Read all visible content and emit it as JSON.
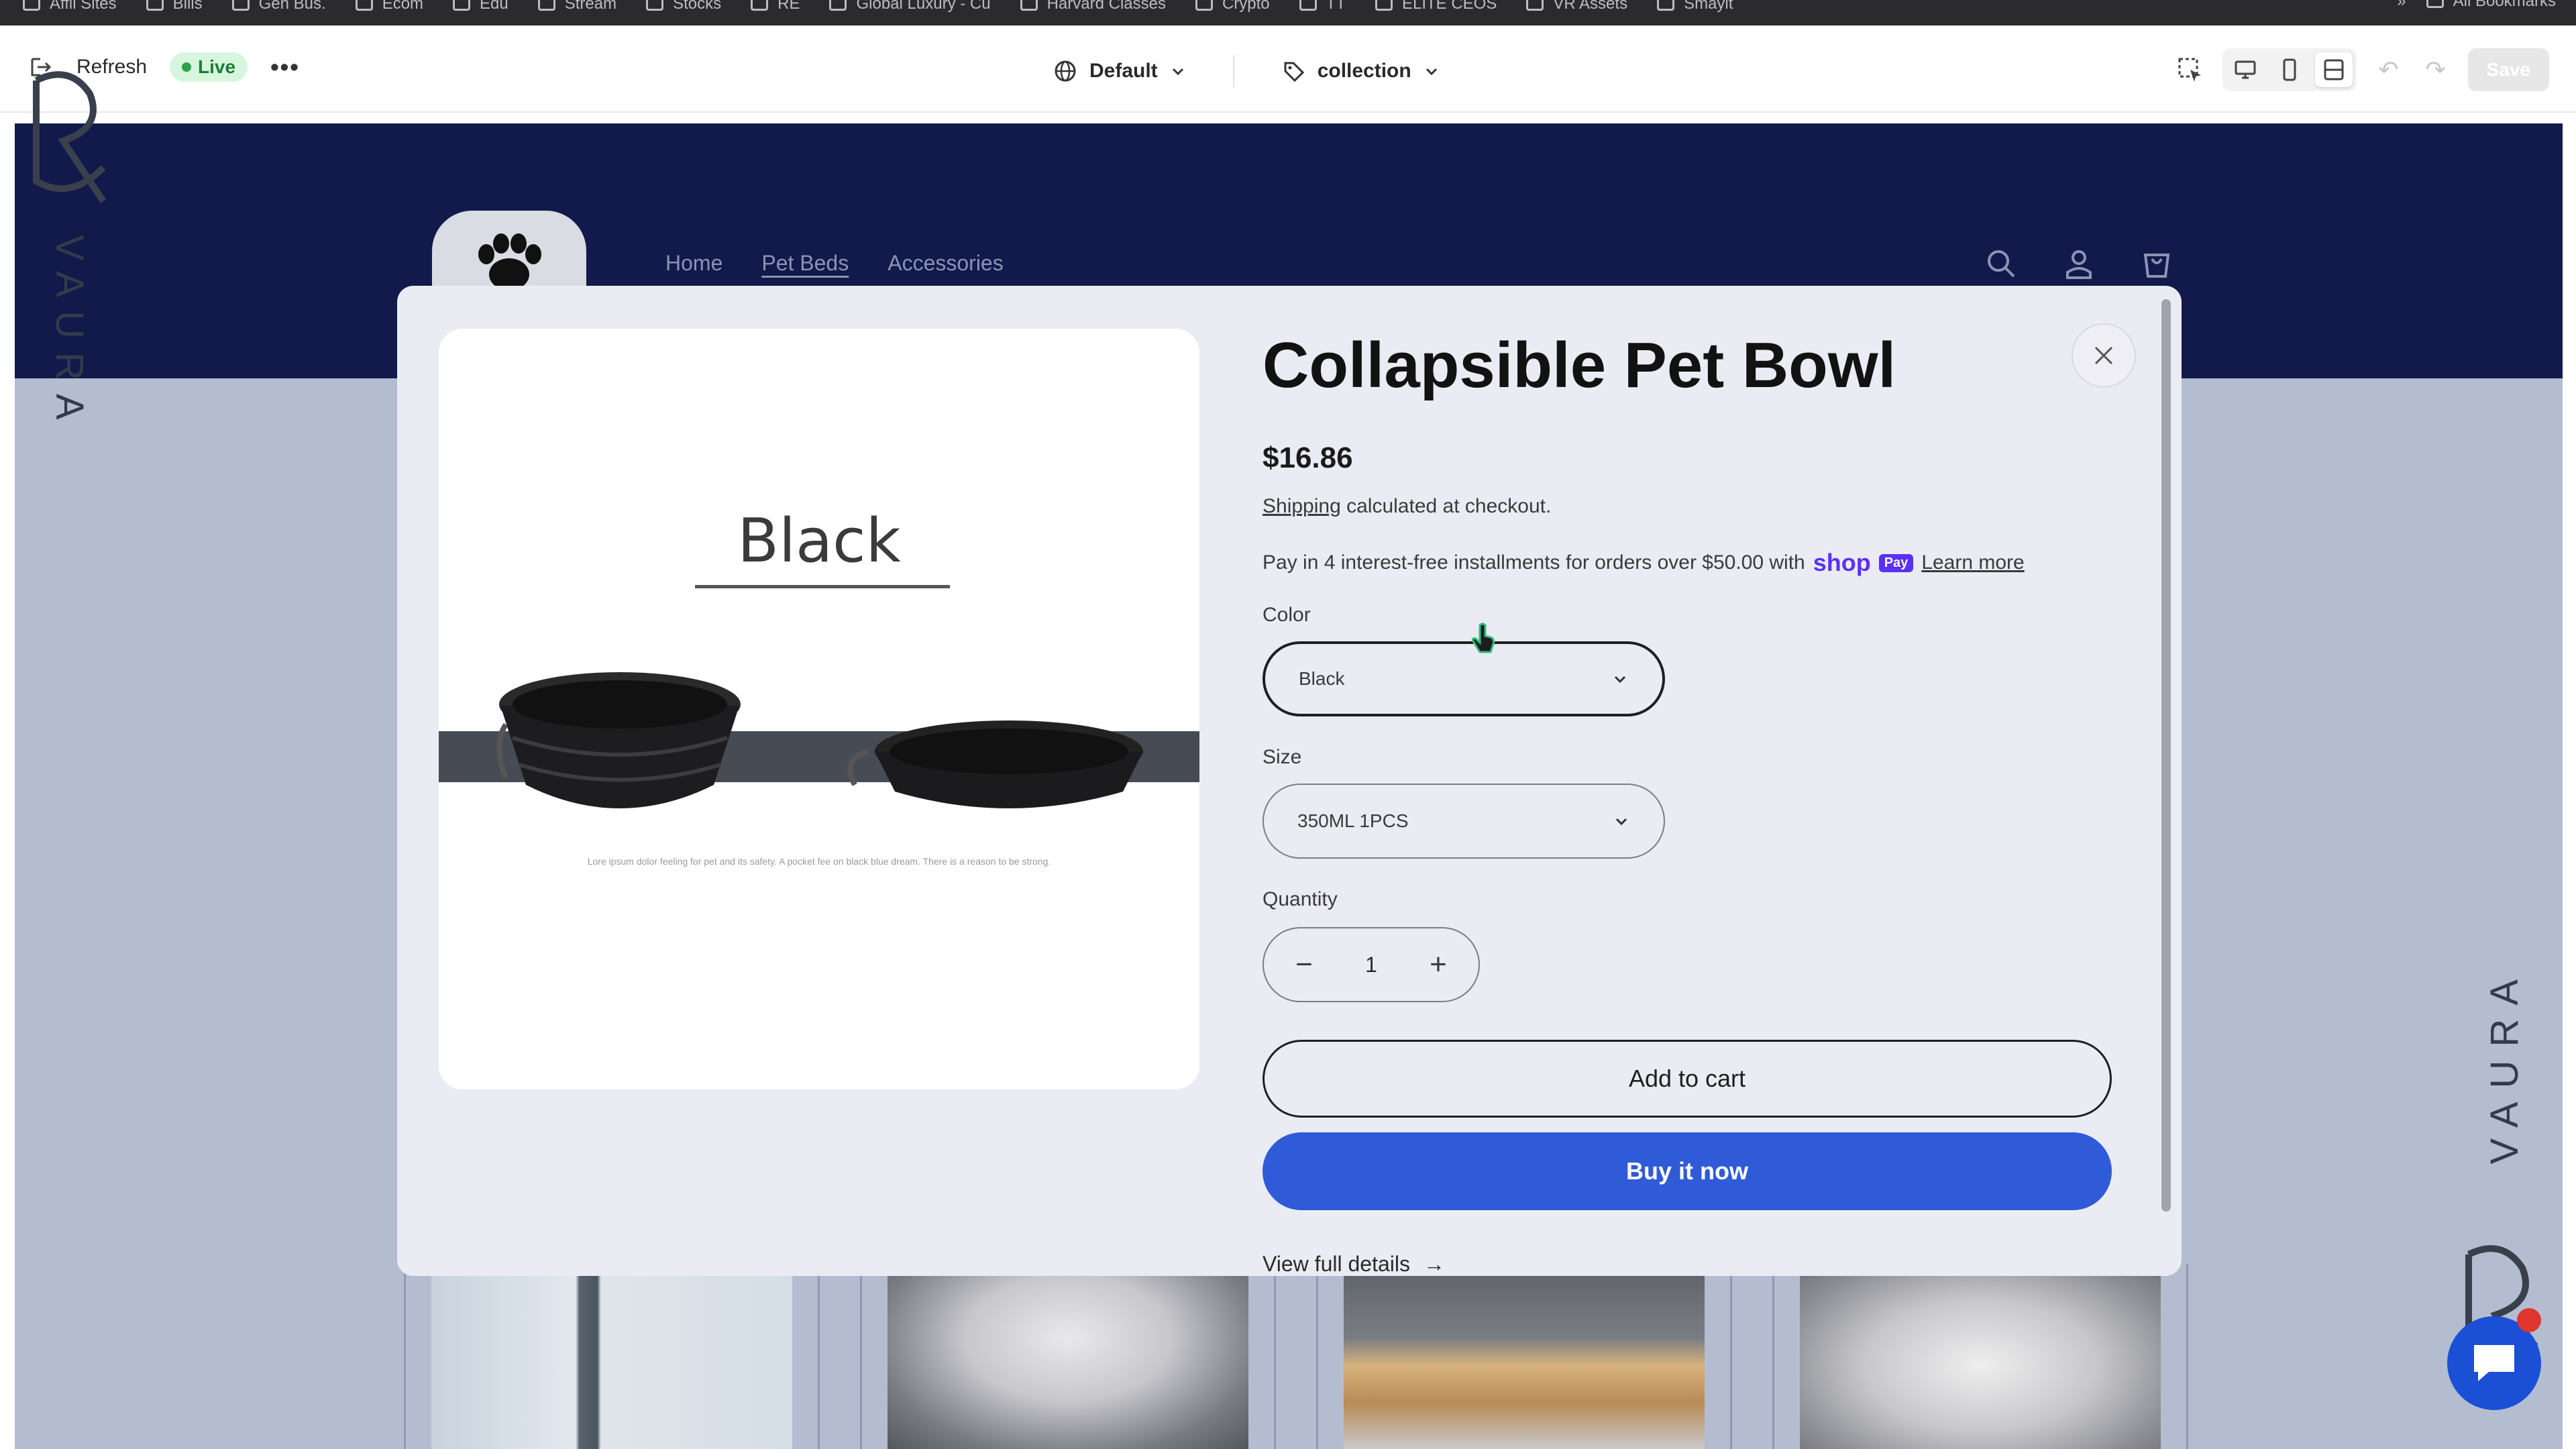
{
  "bookmarks": [
    "Affil Sites",
    "Bills",
    "Gen Bus.",
    "Ecom",
    "Edu",
    "Stream",
    "Stocks",
    "RE",
    "Global Luxury - Cu",
    "Harvard Classes",
    "Crypto",
    "TT",
    "ELITE CEOS",
    "VR Assets",
    "Smaylt"
  ],
  "bookmarks_overflow": "»",
  "bookmarks_all": "All Bookmarks",
  "toolbar": {
    "refresh_label": "Refresh",
    "live_label": "Live",
    "more_label": "•••",
    "theme_label": "Default",
    "template_label": "collection",
    "save_label": "Save"
  },
  "watermark": {
    "text": "VAURA"
  },
  "store": {
    "nav": [
      "Home",
      "Pet Beds",
      "Accessories"
    ],
    "active_nav": "Pet Beds"
  },
  "product": {
    "image_label": "Black",
    "image_fine_print": "Lore ipsum dolor feeling for pet and its safety. A pocket fee on black blue dream. There is a reason to be strong.",
    "title": "Collapsible Pet Bowl",
    "price": "$16.86",
    "shipping_link": "Shipping",
    "shipping_text": "calculated at checkout.",
    "installments_text": "Pay in 4 interest-free installments for orders over $50.00 with",
    "shop_word": "shop",
    "pay_badge": "Pay",
    "learn_more": "Learn more",
    "color_label": "Color",
    "color_value": "Black",
    "size_label": "Size",
    "size_value": "350ML 1PCS",
    "quantity_label": "Quantity",
    "quantity_value": "1",
    "qty_minus": "−",
    "qty_plus": "+",
    "add_to_cart": "Add to cart",
    "buy_now": "Buy it now",
    "view_details": "View full details",
    "view_details_arrow": "→"
  },
  "colors": {
    "header_navy": "#111a4a",
    "page_bg": "#b4bdd0",
    "buy_blue": "#2f5bd8",
    "shop_purple": "#5a31f4",
    "live_green": "#2ea24b"
  }
}
